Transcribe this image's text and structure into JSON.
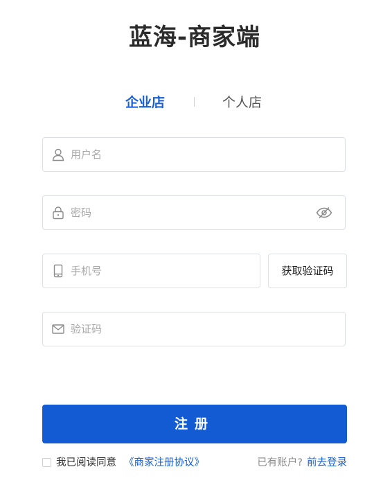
{
  "title": "蓝海-商家端",
  "tabs": {
    "active": "企业店",
    "inactive": "个人店"
  },
  "form": {
    "username_placeholder": "用户名",
    "password_placeholder": "密码",
    "phone_placeholder": "手机号",
    "code_placeholder": "验证码",
    "sms_button": "获取验证码",
    "submit_label": "注册"
  },
  "agreement": {
    "prefix": "我已阅读同意",
    "link": "《商家注册协议》"
  },
  "login": {
    "question": "已有账户?",
    "link": "前去登录"
  },
  "colors": {
    "primary": "#135bd3",
    "link": "#1a5fd1",
    "border": "#dcdfe6"
  },
  "icons": [
    "user-icon",
    "lock-icon",
    "eye-off-icon",
    "phone-icon",
    "mail-icon"
  ]
}
